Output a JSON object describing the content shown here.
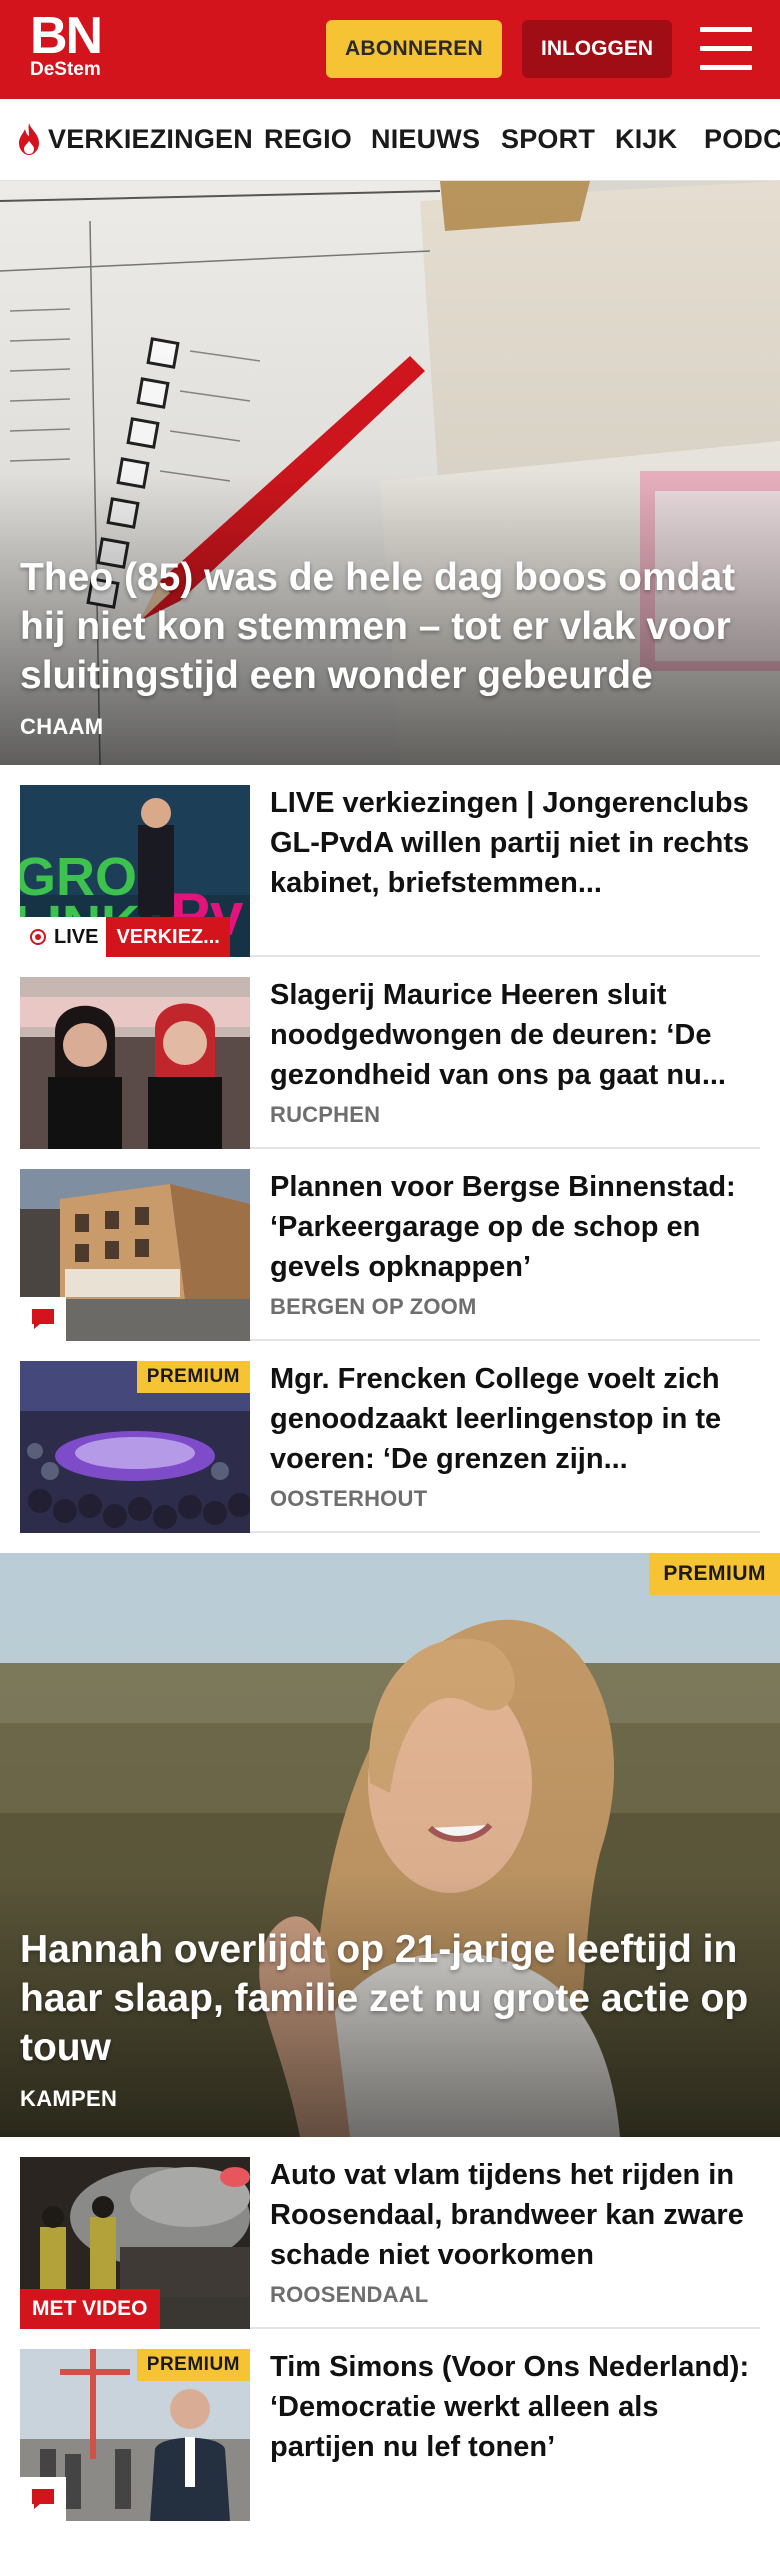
{
  "header": {
    "logo_big": "BN",
    "logo_small": "DeStem",
    "subscribe_label": "ABONNEREN",
    "login_label": "INLOGGEN"
  },
  "nav": {
    "items": [
      "VERKIEZINGEN",
      "REGIO",
      "NIEUWS",
      "SPORT",
      "KIJK",
      "PODC"
    ]
  },
  "hero1": {
    "title": "Theo (85) was de hele dag boos omdat hij niet kon stemmen – tot er vlak voor sluitingstijd een wonder gebeurde",
    "location": "CHAAM"
  },
  "articles": [
    {
      "title": "LIVE verkiezingen | Jongeren­clubs GL-PvdA willen partij niet in rechts kabinet, briefstemmen...",
      "live_label": "LIVE",
      "tag": "VERKIEZ..."
    },
    {
      "title": "Slagerij Maurice Heeren sluit noodgedwongen de deuren: ‘De gezondheid van ons pa gaat nu...",
      "location": "RUCPHEN"
    },
    {
      "title": "Plannen voor Bergse Binnenstad: ‘Parkeergarage op de schop en gevels opknappen’",
      "location": "BERGEN OP ZOOM"
    },
    {
      "title": "Mgr. Frencken College voelt zich genoodzaakt leerlingenstop in te voeren: ‘De grenzen zijn...",
      "location": "OOSTERHOUT",
      "badge": "PREMIUM"
    }
  ],
  "hero2": {
    "badge": "PREMIUM",
    "title": "Hannah overlijdt op 21-jarige leeftijd in haar slaap, familie zet nu grote actie op touw",
    "location": "KAMPEN"
  },
  "articles2": [
    {
      "title": "Auto vat vlam tijdens het rijden in Roosendaal, brandweer kan zware schade niet voorkomen",
      "location": "ROOSENDAAL",
      "video_label": "MET VIDEO"
    },
    {
      "title": "Tim Simons (Voor Ons Nederland): ‘Democratie werkt alleen als partijen nu lef tonen’",
      "badge": "PREMIUM"
    }
  ],
  "colors": {
    "brand_red": "#d3141c",
    "premium_yellow": "#f6c334",
    "login_dark_red": "#a10d14"
  }
}
